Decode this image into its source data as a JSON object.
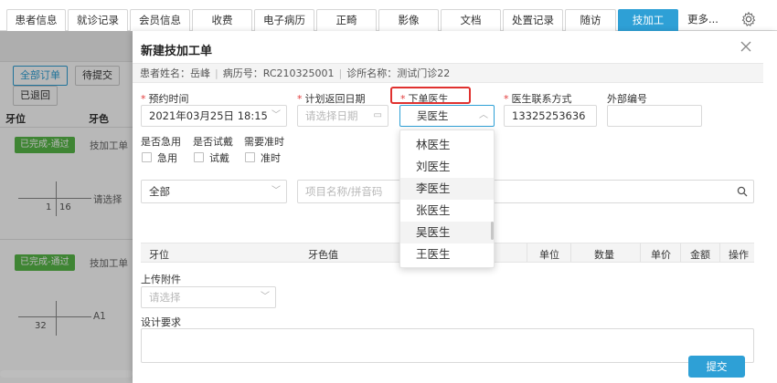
{
  "tabs": [
    "患者信息",
    "就诊记录",
    "会员信息",
    "收费",
    "电子病历",
    "正畸",
    "影像",
    "文档",
    "处置记录",
    "随访",
    "技加工"
  ],
  "tab_more": "更多...",
  "background": {
    "filter_buttons": [
      "全部订单",
      "待提交",
      "已退回"
    ],
    "columns": [
      "牙位",
      "牙色"
    ],
    "rows": [
      {
        "badge": "已完成-通过",
        "label": "技加工单",
        "tooth_left": "1",
        "tooth_right": "16",
        "note": "请选择"
      },
      {
        "badge": "已完成-通过",
        "label": "技加工单",
        "tooth_left": "32",
        "tooth_right": "",
        "note": "A1"
      }
    ]
  },
  "modal": {
    "title": "新建技加工单",
    "info": {
      "patient": "患者姓名：岳峰",
      "record": "病历号：RC210325001",
      "clinic": "诊所名称：测试门诊22"
    },
    "fields": {
      "appt_label": "预约时间",
      "appt_value": "2021年03月25日 18:15",
      "return_label": "计划返回日期",
      "return_placeholder": "请选择日期",
      "doctor_label": "下单医生",
      "doctor_value": "吴医生",
      "phone_label": "医生联系方式",
      "phone_value": "13325253636",
      "external_label": "外部编号",
      "external_value": ""
    },
    "options": {
      "urgent_label": "是否急用",
      "trial_label": "是否试戴",
      "ontime_label": "需要准时",
      "urgent_cb": "急用",
      "trial_cb": "试戴",
      "ontime_cb": "准时"
    },
    "filter_select": "全部",
    "search_placeholder": "项目名称/拼音码",
    "table_columns": [
      "牙位",
      "牙色值",
      "单位",
      "数量",
      "单价",
      "金额",
      "操作"
    ],
    "upload_label": "上传附件",
    "upload_placeholder": "请选择",
    "design_label": "设计要求",
    "submit_label": "提交"
  },
  "doctor_dropdown": [
    "林医生",
    "刘医生",
    "李医生",
    "张医生",
    "吴医生",
    "王医生"
  ]
}
